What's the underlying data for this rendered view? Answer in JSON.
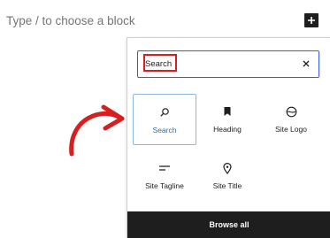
{
  "editor": {
    "placeholder": "Type / to choose a block",
    "add_block_icon": "plus-icon"
  },
  "inserter": {
    "search": {
      "value": "Search",
      "clear_icon": "close-icon"
    },
    "blocks": [
      {
        "label": "Search",
        "icon": "search-icon",
        "selected": true
      },
      {
        "label": "Heading",
        "icon": "bookmark-icon",
        "selected": false
      },
      {
        "label": "Site Logo",
        "icon": "circle-logo-icon",
        "selected": false
      },
      {
        "label": "Site Tagline",
        "icon": "tagline-icon",
        "selected": false
      },
      {
        "label": "Site Title",
        "icon": "map-pin-icon",
        "selected": false
      }
    ],
    "browse_all_label": "Browse all"
  },
  "colors": {
    "annotation_red": "#d81f1f",
    "focus_blue": "#3858e9",
    "selected_text": "#2a6fb3",
    "dark": "#1e1e1e"
  }
}
